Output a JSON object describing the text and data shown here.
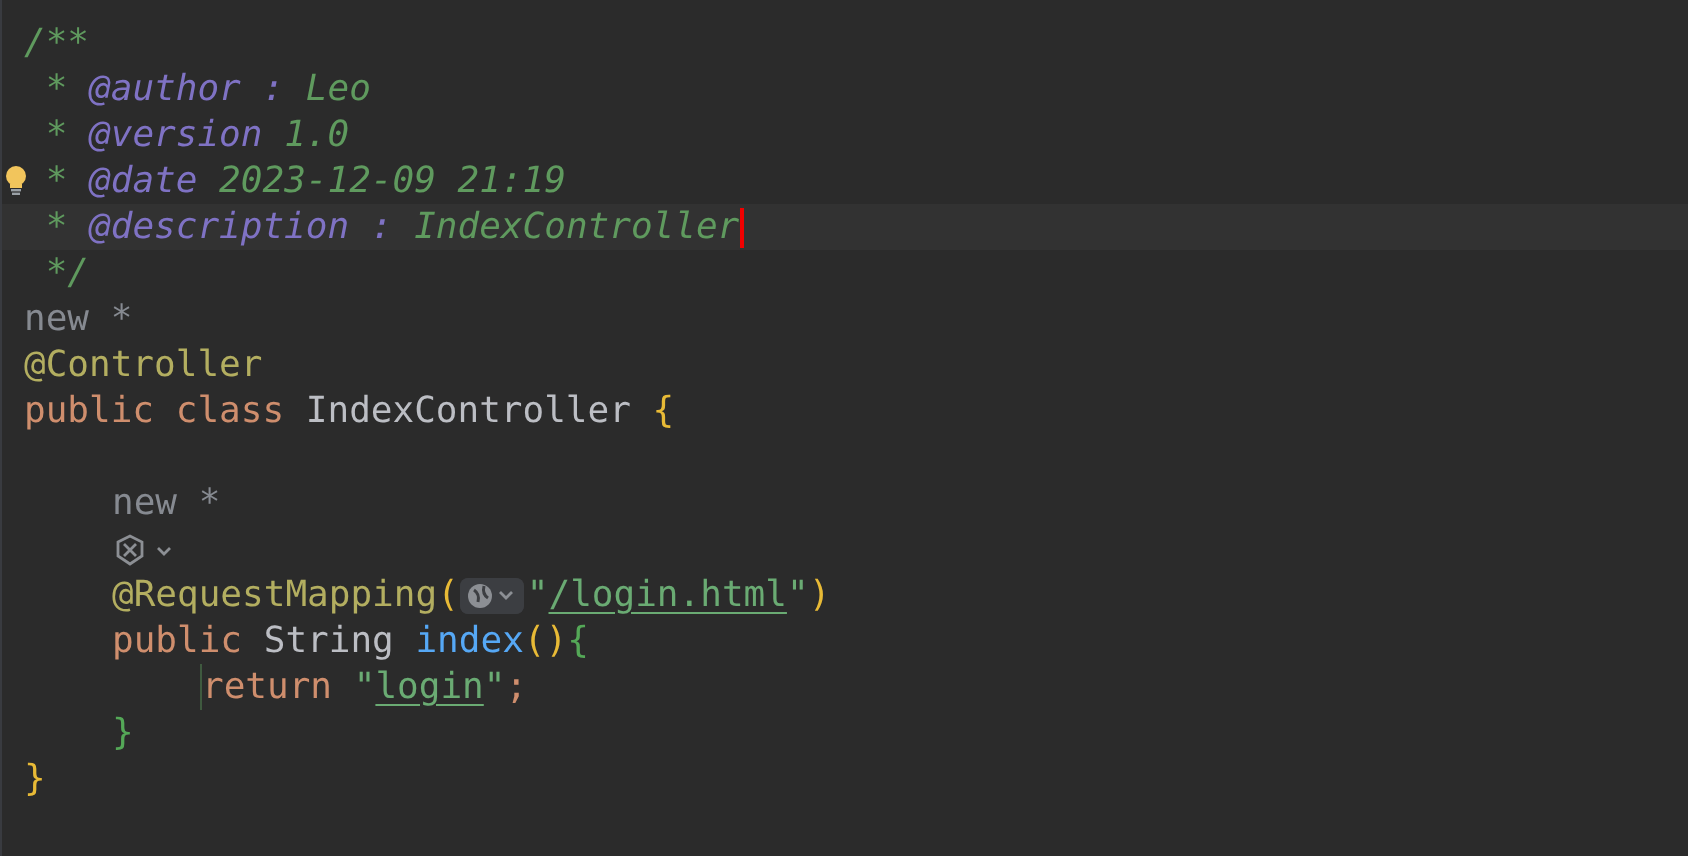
{
  "editor": {
    "lines": [
      {
        "kind": "code",
        "current": false,
        "tokens": [
          {
            "kind": "comment",
            "text": "/**"
          }
        ]
      },
      {
        "kind": "code",
        "current": false,
        "tokens": [
          {
            "kind": "comment",
            "text": " *"
          },
          {
            "kind": "tag",
            "text": " @author :"
          },
          {
            "kind": "comment",
            "text": " Leo"
          }
        ]
      },
      {
        "kind": "code",
        "current": false,
        "tokens": [
          {
            "kind": "comment",
            "text": " *"
          },
          {
            "kind": "tag",
            "text": " @version"
          },
          {
            "kind": "comment",
            "text": " 1.0"
          }
        ]
      },
      {
        "kind": "code",
        "current": false,
        "intention": true,
        "tokens": [
          {
            "kind": "comment",
            "text": " *"
          },
          {
            "kind": "tag",
            "text": " @date"
          },
          {
            "kind": "comment",
            "text": " 2023-12-09 21:19"
          }
        ]
      },
      {
        "kind": "code",
        "current": true,
        "tokens": [
          {
            "kind": "comment",
            "text": " *"
          },
          {
            "kind": "tag",
            "text": " @description :"
          },
          {
            "kind": "comment",
            "text": " IndexController"
          }
        ]
      },
      {
        "kind": "code",
        "current": false,
        "tokens": [
          {
            "kind": "comment",
            "text": " */"
          }
        ]
      },
      {
        "kind": "code",
        "current": false,
        "tokens": [
          {
            "kind": "hint",
            "text": "new *"
          }
        ]
      },
      {
        "kind": "code",
        "current": false,
        "tokens": [
          {
            "kind": "annotation",
            "text": "@Controller"
          }
        ]
      },
      {
        "kind": "code",
        "current": false,
        "tokens": [
          {
            "kind": "keyword",
            "text": "public class "
          },
          {
            "kind": "plain",
            "text": "IndexController "
          },
          {
            "kind": "brace",
            "text": "{",
            "color": "#e8ba36"
          }
        ],
        "children": [
          {
            "kind": "blank",
            "current": false
          },
          {
            "kind": "code",
            "current": false,
            "tokens": [
              {
                "kind": "hint",
                "text": "new *"
              }
            ]
          },
          {
            "kind": "code",
            "current": false,
            "tokens": [
              {
                "kind": "bean"
              }
            ]
          },
          {
            "kind": "code",
            "current": false,
            "tokens": [
              {
                "kind": "annotation",
                "text": "@RequestMapping"
              },
              {
                "kind": "brace",
                "text": "(",
                "color": "#e8ba36"
              },
              {
                "kind": "url-inlay"
              },
              {
                "kind": "string",
                "text": "\""
              },
              {
                "kind": "string",
                "text": "/login.html",
                "underlined": true
              },
              {
                "kind": "string",
                "text": "\""
              },
              {
                "kind": "brace",
                "text": ")",
                "color": "#e8ba36"
              }
            ]
          },
          {
            "kind": "code",
            "current": false,
            "tokens": [
              {
                "kind": "keyword",
                "text": "public "
              },
              {
                "kind": "plain",
                "text": "String "
              },
              {
                "kind": "method",
                "text": "index"
              },
              {
                "kind": "brace",
                "text": "()",
                "color": "#e8ba36"
              },
              {
                "kind": "brace",
                "text": "{",
                "color": "#54a857"
              }
            ],
            "children": [
              {
                "kind": "code",
                "current": false,
                "tokens": [
                  {
                    "kind": "keyword",
                    "text": "return "
                  },
                  {
                    "kind": "string",
                    "text": "\""
                  },
                  {
                    "kind": "string",
                    "text": "login",
                    "underlined": true
                  },
                  {
                    "kind": "string",
                    "text": "\""
                  },
                  {
                    "kind": "keyword",
                    "text": ";"
                  }
                ]
              }
            ]
          },
          {
            "kind": "code",
            "current": false,
            "tokens": [
              {
                "kind": "brace",
                "text": "}",
                "color": "#54a857"
              }
            ]
          }
        ]
      },
      {
        "kind": "code",
        "current": false,
        "tokens": [
          {
            "kind": "brace",
            "text": "}",
            "color": "#e8ba36"
          }
        ]
      }
    ]
  }
}
